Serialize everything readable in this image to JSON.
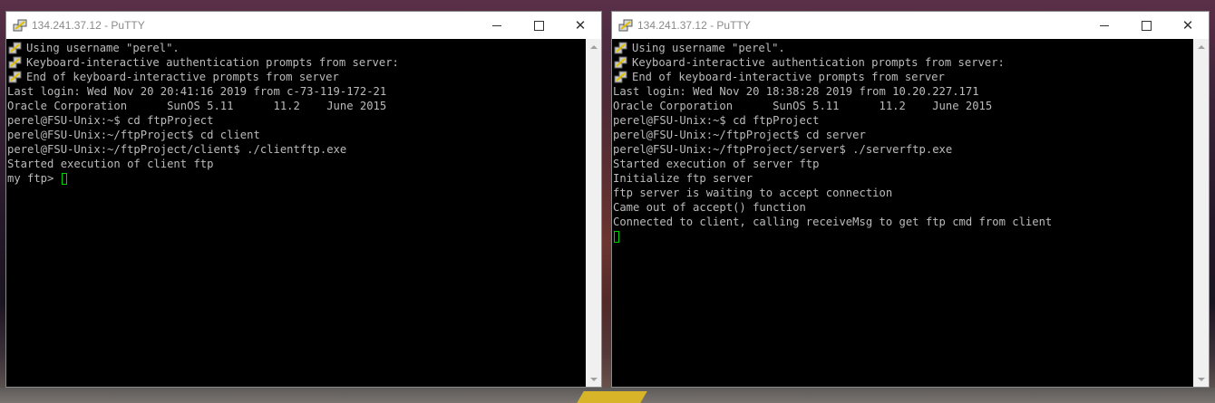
{
  "colors": {
    "terminal_bg": "#000000",
    "terminal_fg": "#bbbbbb",
    "cursor": "#00d000",
    "titlebar_text": "#8a8a8a"
  },
  "windows": [
    {
      "title": "134.241.37.12 - PuTTY",
      "lines": [
        {
          "icon": "putty-icon",
          "text": "Using username \"perel\"."
        },
        {
          "icon": "putty-icon",
          "text": "Keyboard-interactive authentication prompts from server:"
        },
        {
          "icon": "putty-icon",
          "text": "End of keyboard-interactive prompts from server"
        },
        {
          "text": "Last login: Wed Nov 20 20:41:16 2019 from c-73-119-172-21"
        },
        {
          "text": "Oracle Corporation      SunOS 5.11      11.2    June 2015"
        },
        {
          "text": "perel@FSU-Unix:~$ cd ftpProject"
        },
        {
          "text": "perel@FSU-Unix:~/ftpProject$ cd client"
        },
        {
          "text": "perel@FSU-Unix:~/ftpProject/client$ ./clientftp.exe"
        },
        {
          "text": "Started execution of client ftp"
        },
        {
          "text": "my ftp> ",
          "cursor": true
        }
      ]
    },
    {
      "title": "134.241.37.12 - PuTTY",
      "lines": [
        {
          "icon": "putty-icon",
          "text": "Using username \"perel\"."
        },
        {
          "icon": "putty-icon",
          "text": "Keyboard-interactive authentication prompts from server:"
        },
        {
          "icon": "putty-icon",
          "text": "End of keyboard-interactive prompts from server"
        },
        {
          "text": "Last login: Wed Nov 20 18:38:28 2019 from 10.20.227.171"
        },
        {
          "text": "Oracle Corporation      SunOS 5.11      11.2    June 2015"
        },
        {
          "text": "perel@FSU-Unix:~$ cd ftpProject"
        },
        {
          "text": "perel@FSU-Unix:~/ftpProject$ cd server"
        },
        {
          "text": "perel@FSU-Unix:~/ftpProject/server$ ./serverftp.exe"
        },
        {
          "text": "Started execution of server ftp"
        },
        {
          "text": "Initialize ftp server"
        },
        {
          "text": "ftp server is waiting to accept connection"
        },
        {
          "text": "Came out of accept() function"
        },
        {
          "text": "Connected to client, calling receiveMsg to get ftp cmd from client"
        },
        {
          "text": "",
          "cursor": true
        }
      ]
    }
  ]
}
